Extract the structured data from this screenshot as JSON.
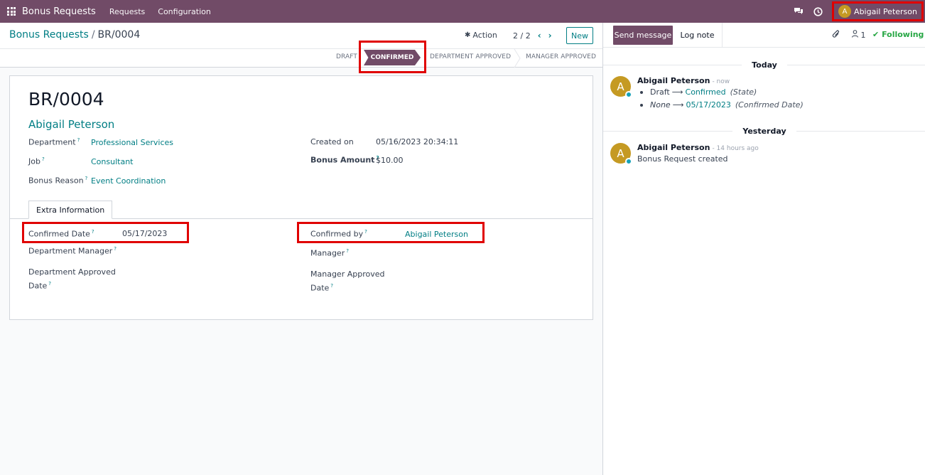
{
  "navbar": {
    "app_name": "Bonus Requests",
    "menu": [
      "Requests",
      "Configuration"
    ],
    "user": {
      "initial": "A",
      "name": "Abigail Peterson"
    }
  },
  "control": {
    "breadcrumb_parent": "Bonus Requests",
    "breadcrumb_current": "BR/0004",
    "action_label": "Action",
    "pager": "2 / 2",
    "new_label": "New"
  },
  "statusbar": {
    "stages": [
      "DRAFT",
      "CONFIRMED",
      "DEPARTMENT APPROVED",
      "MANAGER APPROVED"
    ],
    "active": "CONFIRMED"
  },
  "form": {
    "reference": "BR/0004",
    "employee": "Abigail Peterson",
    "department_label": "Department",
    "department_value": "Professional Services",
    "job_label": "Job",
    "job_value": "Consultant",
    "reason_label": "Bonus Reason",
    "reason_value": "Event Coordination",
    "created_on_label": "Created on",
    "created_on_value": "05/16/2023 20:34:11",
    "amount_label": "Bonus Amount",
    "amount_value": "$10.00",
    "help_mark": "?",
    "tab_label": "Extra Information",
    "confirmed_date_label": "Confirmed Date",
    "confirmed_date_value": "05/17/2023",
    "confirmed_by_label": "Confirmed by",
    "confirmed_by_value": "Abigail Peterson",
    "dept_manager_label": "Department Manager",
    "manager_label": "Manager",
    "dept_approved_date_label_1": "Department Approved",
    "dept_approved_date_label_2": "Date",
    "mgr_approved_date_label_1": "Manager Approved",
    "mgr_approved_date_label_2": "Date"
  },
  "chatter": {
    "send_message": "Send message",
    "log_note": "Log note",
    "followers_count": "1",
    "following": "Following",
    "today": "Today",
    "yesterday": "Yesterday",
    "msg1": {
      "initial": "A",
      "author": "Abigail Peterson",
      "time": "- now",
      "line1_old": "Draft",
      "line1_new": "Confirmed",
      "line1_field": "(State)",
      "line2_old": "None",
      "line2_new": "05/17/2023",
      "line2_field": "(Confirmed Date)"
    },
    "msg2": {
      "initial": "A",
      "author": "Abigail Peterson",
      "time": "- 14 hours ago",
      "body": "Bonus Request created"
    }
  },
  "colors": {
    "brand": "#714B67",
    "link": "#017e84",
    "highlight": "#e00000",
    "avatar": "#c59a23",
    "following": "#28a745"
  }
}
